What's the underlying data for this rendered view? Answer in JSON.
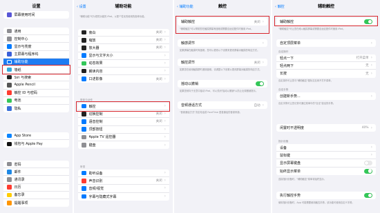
{
  "colors": {
    "blue": "#007aff",
    "green": "#34c759",
    "red_highlight": "#d7252c",
    "selected": "#1d7cf2"
  },
  "settings": {
    "title": "设置",
    "group1": [
      {
        "label": "屏幕使用时间",
        "color": "#5856d6"
      }
    ],
    "group2": [
      {
        "label": "通用",
        "color": "#8e8e93"
      },
      {
        "label": "控制中心",
        "color": "#8e8e93"
      },
      {
        "label": "显示与亮度",
        "color": "#007aff"
      },
      {
        "label": "主屏幕与程序坞",
        "color": "#3a5fd8"
      },
      {
        "label": "辅助功能",
        "color": "#007aff",
        "selected": true
      },
      {
        "label": "墙纸",
        "color": "#35aadc"
      },
      {
        "label": "Siri 与搜索",
        "color": "#222222"
      },
      {
        "label": "Apple Pencil",
        "color": "#555555"
      },
      {
        "label": "触控 ID 与密码",
        "color": "#ff3b30"
      },
      {
        "label": "电池",
        "color": "#34c759"
      },
      {
        "label": "隐私",
        "color": "#3a6fd8"
      }
    ],
    "group3": [
      {
        "label": "App Store",
        "color": "#0a84ff"
      },
      {
        "label": "钱包与 Apple Pay",
        "color": "#111111"
      }
    ],
    "group4": [
      {
        "label": "密码",
        "color": "#8e8e93"
      },
      {
        "label": "邮件",
        "color": "#1e88e5"
      },
      {
        "label": "通讯录",
        "color": "#8e8e93"
      },
      {
        "label": "日历",
        "color": "#ff3b30"
      },
      {
        "label": "备忘录",
        "color": "#ffcc00"
      },
      {
        "label": "提醒事项",
        "color": "#ff9500"
      }
    ]
  },
  "accessibility": {
    "back": "设置",
    "title": "辅助功能",
    "desc": "\"辅助功能\"可为视觉功能的 iPad。以更个性化的使用的各种功能。",
    "group_vision": [
      {
        "label": "旁白",
        "color": "#222222",
        "value": "关闭"
      },
      {
        "label": "缩放",
        "color": "#222222",
        "value": "关闭"
      },
      {
        "label": "放大器",
        "color": "#222222",
        "value": "关闭"
      },
      {
        "label": "显示与文字大小",
        "color": "#007aff",
        "value": ""
      },
      {
        "label": "动态效果",
        "color": "#34c759",
        "value": ""
      },
      {
        "label": "朗读内容",
        "color": "#222222",
        "value": ""
      },
      {
        "label": "口述影像",
        "color": "#007aff",
        "value": "关闭"
      }
    ],
    "hdr_physical": "肢体与动作",
    "group_physical": [
      {
        "label": "触控",
        "color": "#007aff",
        "value": ""
      },
      {
        "label": "切换控制",
        "color": "#222222",
        "value": "关闭"
      },
      {
        "label": "语音控制",
        "color": "#007aff",
        "value": "关闭"
      },
      {
        "label": "顶部按钮",
        "color": "#007aff",
        "value": ""
      },
      {
        "label": "Apple TV 遥控器",
        "color": "#8e8e93",
        "value": ""
      },
      {
        "label": "键盘",
        "color": "#8e8e93",
        "value": ""
      }
    ],
    "hdr_hearing": "听觉",
    "group_hearing": [
      {
        "label": "助听设备",
        "color": "#007aff",
        "value": ""
      },
      {
        "label": "声音识别",
        "color": "#ff3b30",
        "value": "关闭"
      },
      {
        "label": "音频/视觉",
        "color": "#007aff",
        "value": ""
      },
      {
        "label": "字幕与隐藏式字幕",
        "color": "#007aff",
        "value": ""
      }
    ]
  },
  "touch": {
    "back": "辅助功能",
    "title": "触控",
    "assistive_label": "辅助触控",
    "assistive_value": "关闭",
    "assistive_desc": "\"辅助触控\"可以帮助您在触摸屏幕有困难或需要自适应配件时使用 iPad。",
    "touch_adapt_label": "触感调节",
    "touch_adapt_value": "",
    "touch_adapt_desc": "如果屏幕在触摸时有困难，您可以更改以下设置来更改屏幕对触摸的响应方式。",
    "haptic_label": "触控调节",
    "haptic_value": "关闭",
    "haptic_desc": "如果您在使用触摸屏时遇到困难，请调整以下设置以更改屏幕对触摸的响应方式。",
    "shake_label": "摇动以撤销",
    "shake_desc": "如果您倾向于无意中摇动 iPad，可以关闭\"摇动以撤销\"以防止出现撤销提示。",
    "audio_label": "音频通话方式",
    "audio_value": "自动",
    "audio_desc": "\"音频通话方式\"决定电话或 FaceTime 语音通话的音频来源。"
  },
  "assistive": {
    "back": "触控",
    "title": "辅助触控",
    "toggle_label": "辅助触控",
    "toggle_desc": "\"辅助触控\"可让您在难以触摸屏幕或需要自适应配件时使用 iPad。",
    "customize_label": "自定顶层菜单",
    "hdr_custom": "自定操作",
    "actions": [
      {
        "label": "轻点一下",
        "value": "打开菜单"
      },
      {
        "label": "轻点两下",
        "value": "无"
      },
      {
        "label": "长按",
        "value": "无"
      }
    ],
    "actions_desc": "自定操作可让您与\"辅助触控\"图标交互而不打开菜单。",
    "hdr_gesture": "自定手势",
    "create_label": "创建新手势...",
    "create_desc": "自定手势可让您记录可通过菜单中的\"自定\"激活的手势。",
    "idle_label": "闲置时不透明度",
    "idle_value": "40%",
    "hdr_pointer": "指针设备",
    "pointer_items": [
      {
        "label": "设备",
        "kind": "chev"
      },
      {
        "label": "鼠标键",
        "kind": "chev"
      },
      {
        "label": "显示屏幕键盘",
        "kind": "toggle-off"
      },
      {
        "label": "始终显示菜单",
        "kind": "toggle-on"
      }
    ],
    "pointer_desc": "连接指针设备时，\"辅助触控\"菜单将始终显示。",
    "confirm_label": "执行触控手势",
    "confirm_desc": "使用指针设备时，App 可能需要使用触控手势。该功能可使用自定义手势。"
  }
}
